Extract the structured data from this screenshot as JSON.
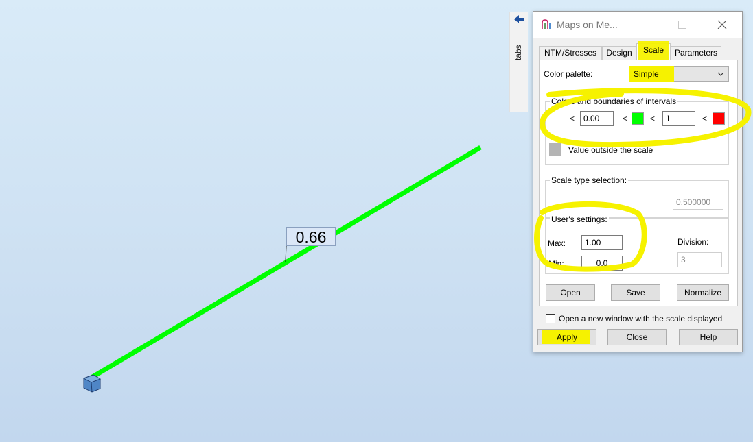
{
  "viewport": {
    "beam_label": "0.66",
    "beam_color": "#00ff00",
    "background_top": "#d9ebf8",
    "background_bottom": "#c2d7ee"
  },
  "side_panel": {
    "label": "tabs",
    "icon": "arrow-left-icon"
  },
  "dialog": {
    "title": "Maps on Me...",
    "tabs": [
      {
        "label": "NTM/Stresses",
        "active": false
      },
      {
        "label": "Design",
        "active": false
      },
      {
        "label": "Scale",
        "active": true
      },
      {
        "label": "Parameters",
        "active": false
      }
    ],
    "color_palette": {
      "label": "Color palette:",
      "value": "Simple"
    },
    "intervals": {
      "title": "Colors and boundaries of intervals",
      "lt": "<",
      "boundary1": "0.00",
      "boundary2": "1",
      "color_low": "#ffffff",
      "color_mid": "#00ff00",
      "color_high": "#ff0000",
      "outside_label": "Value outside the scale",
      "outside_color": "#b4b4b4"
    },
    "scale_type": {
      "title": "Scale type selection:",
      "value": "0.500000"
    },
    "user_settings": {
      "title": "User's settings:",
      "max_label": "Max:",
      "max_value": "1.00",
      "min_label": "Min:",
      "min_value": "0.0",
      "division_label": "Division:",
      "division_value": "3"
    },
    "buttons": {
      "open": "Open",
      "save": "Save",
      "normalize": "Normalize"
    },
    "new_window_checkbox": {
      "label": "Open a new window with the scale displayed",
      "checked": false
    },
    "footer": {
      "apply": "Apply",
      "close": "Close",
      "help": "Help"
    }
  },
  "highlight_color": "#f6f200"
}
